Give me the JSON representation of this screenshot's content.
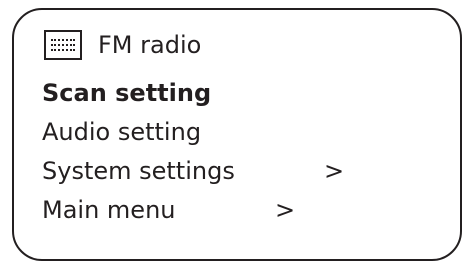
{
  "header": {
    "icon": "radio-icon",
    "title": "FM radio"
  },
  "menu": {
    "items": [
      {
        "label": "Scan setting",
        "selected": true,
        "arrow": ""
      },
      {
        "label": "Audio setting",
        "selected": false,
        "arrow": ""
      },
      {
        "label": "System settings",
        "selected": false,
        "arrow": ">"
      },
      {
        "label": "Main menu",
        "selected": false,
        "arrow": ">"
      }
    ]
  }
}
